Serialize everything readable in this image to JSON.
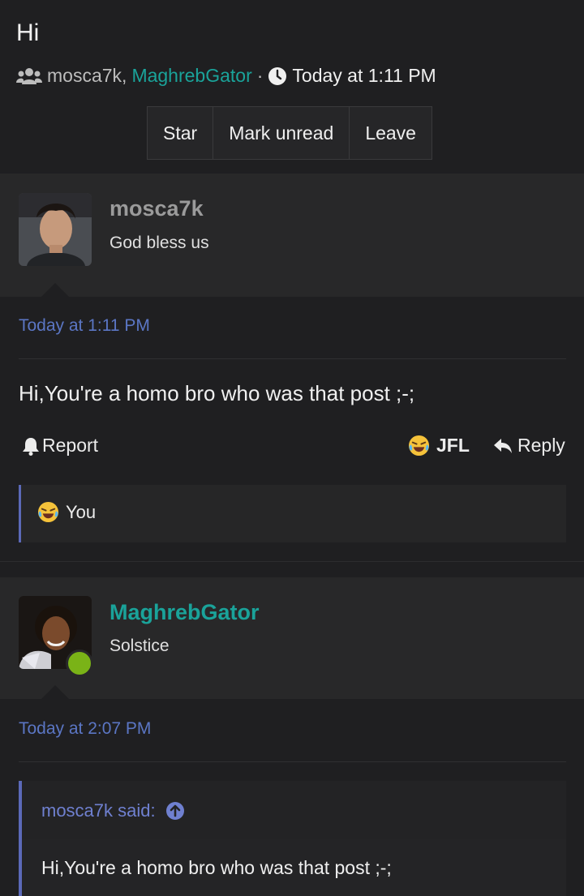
{
  "thread": {
    "title": "Hi",
    "participants": [
      "mosca7k,",
      "MaghrebGator"
    ],
    "separator": "·",
    "timestamp": "Today at 1:11 PM"
  },
  "toolbar": {
    "star": "Star",
    "mark_unread": "Mark unread",
    "leave": "Leave"
  },
  "messages": [
    {
      "author": "mosca7k",
      "user_title": "God bless us",
      "time": "Today at 1:11 PM",
      "body": "Hi,You're a homo bro who was that post ;-;",
      "actions": {
        "report": "Report",
        "reaction": "JFL",
        "reply": "Reply"
      },
      "reactions": {
        "text": "You",
        "emoji": "laughing-crying-emoji"
      },
      "author_color": "#9b9b9b"
    },
    {
      "author": "MaghrebGator",
      "user_title": "Solstice",
      "time": "Today at 2:07 PM",
      "online": true,
      "author_color": "#1aa39a",
      "quote": {
        "author": "mosca7k said:",
        "body": "Hi,You're a homo bro who was that post ;-;"
      }
    }
  ],
  "colors": {
    "accent": "#5b69b8",
    "teal": "#1aa39a",
    "online": "#7ab317",
    "background": "#1f1f21"
  }
}
